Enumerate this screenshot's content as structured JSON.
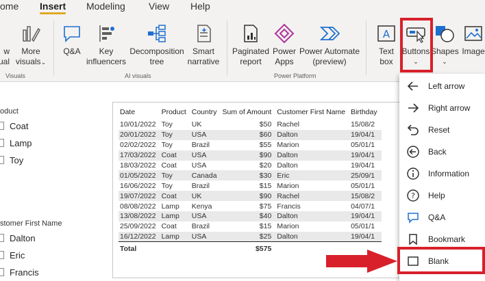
{
  "tabs": [
    {
      "label": "ome",
      "active": false
    },
    {
      "label": "Insert",
      "active": true
    },
    {
      "label": "Modeling",
      "active": false
    },
    {
      "label": "View",
      "active": false
    },
    {
      "label": "Help",
      "active": false
    }
  ],
  "ribbon": {
    "new_visual": {
      "line1": "w",
      "line2": "ual"
    },
    "more_visuals": {
      "line1": "More",
      "line2": "visuals"
    },
    "qna": {
      "line1": "Q&A"
    },
    "key_influencers": {
      "line1": "Key",
      "line2": "influencers"
    },
    "decomposition": {
      "line1": "Decomposition",
      "line2": "tree"
    },
    "smart_narrative": {
      "line1": "Smart",
      "line2": "narrative"
    },
    "paginated": {
      "line1": "Paginated",
      "line2": "report"
    },
    "power_apps": {
      "line1": "Power",
      "line2": "Apps"
    },
    "power_automate": {
      "line1": "Power Automate",
      "line2": "(preview)"
    },
    "text_box": {
      "line1": "Text",
      "line2": "box"
    },
    "buttons": {
      "line1": "Buttons"
    },
    "shapes": {
      "line1": "Shapes"
    },
    "image": {
      "line1": "Image"
    },
    "groups": {
      "visuals": "Visuals",
      "ai_visuals": "AI visuals",
      "power_platform": "Power Platform"
    }
  },
  "fields": {
    "product_header": "oduct",
    "product_items": [
      "Coat",
      "Lamp",
      "Toy"
    ],
    "customer_header": "stomer First Name",
    "customer_items": [
      "Dalton",
      "Eric",
      "Francis"
    ]
  },
  "table": {
    "columns": [
      "Date",
      "Product",
      "Country",
      "Sum of Amount",
      "Customer First Name",
      "Birthday"
    ],
    "rows": [
      [
        "10/01/2022",
        "Toy",
        "UK",
        "$50",
        "Rachel",
        "15/08/2"
      ],
      [
        "20/01/2022",
        "Toy",
        "USA",
        "$60",
        "Dalton",
        "19/04/1"
      ],
      [
        "02/02/2022",
        "Toy",
        "Brazil",
        "$55",
        "Marion",
        "05/01/1"
      ],
      [
        "17/03/2022",
        "Coat",
        "USA",
        "$90",
        "Dalton",
        "19/04/1"
      ],
      [
        "18/03/2022",
        "Coat",
        "USA",
        "$20",
        "Dalton",
        "19/04/1"
      ],
      [
        "01/05/2022",
        "Toy",
        "Canada",
        "$30",
        "Eric",
        "25/09/1"
      ],
      [
        "16/06/2022",
        "Toy",
        "Brazil",
        "$15",
        "Marion",
        "05/01/1"
      ],
      [
        "19/07/2022",
        "Coat",
        "UK",
        "$90",
        "Rachel",
        "15/08/2"
      ],
      [
        "08/08/2022",
        "Lamp",
        "Kenya",
        "$75",
        "Francis",
        "04/07/1"
      ],
      [
        "13/08/2022",
        "Lamp",
        "USA",
        "$40",
        "Dalton",
        "19/04/1"
      ],
      [
        "25/09/2022",
        "Coat",
        "Brazil",
        "$15",
        "Marion",
        "05/01/1"
      ],
      [
        "16/12/2022",
        "Lamp",
        "USA",
        "$25",
        "Dalton",
        "19/04/1"
      ]
    ],
    "total_label": "Total",
    "total_amount": "$575"
  },
  "dropdown": {
    "items": [
      {
        "label": "Left arrow",
        "icon": "left-arrow-icon"
      },
      {
        "label": "Right arrow",
        "icon": "right-arrow-icon"
      },
      {
        "label": "Reset",
        "icon": "reset-icon"
      },
      {
        "label": "Back",
        "icon": "back-icon"
      },
      {
        "label": "Information",
        "icon": "info-icon"
      },
      {
        "label": "Help",
        "icon": "help-icon"
      },
      {
        "label": "Q&A",
        "icon": "qna-icon"
      },
      {
        "label": "Bookmark",
        "icon": "bookmark-icon"
      },
      {
        "label": "Blank",
        "icon": "blank-icon"
      }
    ]
  },
  "colors": {
    "highlight": "#d8202a",
    "accent": "#e0a825",
    "ribbon_bg": "#f3f2f1"
  }
}
